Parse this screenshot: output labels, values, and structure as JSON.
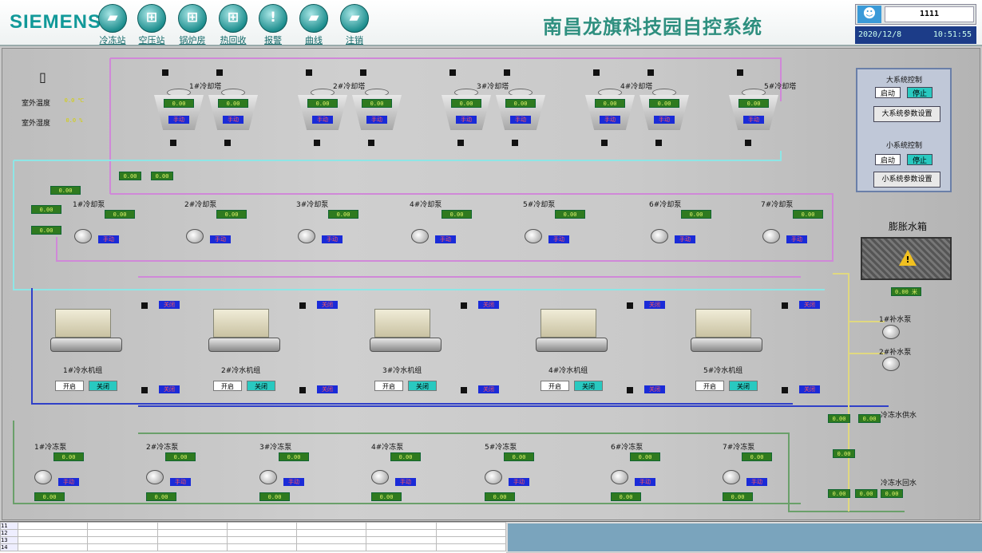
{
  "header": {
    "brand": "SIEMENS",
    "title": "南昌龙旗科技园自控系统",
    "nav": [
      {
        "label": "冷冻站",
        "icon": "folder-icon"
      },
      {
        "label": "空压站",
        "icon": "network-icon"
      },
      {
        "label": "锅炉房",
        "icon": "network-icon"
      },
      {
        "label": "热回收",
        "icon": "network-icon"
      },
      {
        "label": "报警",
        "icon": "warning-icon"
      },
      {
        "label": "曲线",
        "icon": "folder-icon"
      },
      {
        "label": "注销",
        "icon": "folder-icon"
      }
    ],
    "user": "1111",
    "date": "2020/12/8",
    "time": "10:51:55"
  },
  "outdoor": {
    "temp_label": "室外温度",
    "humid_label": "室外湿度",
    "temp_value": "0.0 ℃",
    "humid_value": "0.0 %"
  },
  "towers": [
    {
      "label": "1#冷却塔",
      "state": "手动"
    },
    {
      "label": "2#冷却塔",
      "state": "手动"
    },
    {
      "label": "3#冷却塔",
      "state": "手动"
    },
    {
      "label": "4#冷却塔",
      "state": "手动"
    },
    {
      "label": "5#冷却塔",
      "state": "手动"
    }
  ],
  "cooling_pumps": [
    "1#冷却泵",
    "2#冷却泵",
    "3#冷却泵",
    "4#冷却泵",
    "5#冷却泵",
    "6#冷却泵",
    "7#冷却泵"
  ],
  "chillers": [
    {
      "label": "1#冷水机组",
      "btn1": "开启",
      "btn2": "关闭"
    },
    {
      "label": "2#冷水机组",
      "btn1": "开启",
      "btn2": "关闭"
    },
    {
      "label": "3#冷水机组",
      "btn1": "开启",
      "btn2": "关闭"
    },
    {
      "label": "4#冷水机组",
      "btn1": "开启",
      "btn2": "关闭"
    },
    {
      "label": "5#冷水机组",
      "btn1": "开启",
      "btn2": "关闭"
    }
  ],
  "chilled_pumps": [
    "1#冷冻泵",
    "2#冷冻泵",
    "3#冷冻泵",
    "4#冷冻泵",
    "5#冷冻泵",
    "6#冷冻泵",
    "7#冷冻泵"
  ],
  "value_text": "0.00",
  "status_text": "手动",
  "valve_state": "关闭",
  "control": {
    "big_title": "大系统控制",
    "big_start": "启动",
    "big_stop": "停止",
    "big_param": "大系统参数设置",
    "small_title": "小系统控制",
    "small_start": "启动",
    "small_stop": "停止",
    "small_param": "小系统参数设置"
  },
  "tank": {
    "label": "膨胀水箱",
    "value": "0.00 米"
  },
  "makeup": {
    "pump1": "1#补水泵",
    "pump2": "2#补水泵"
  },
  "supply_label": "冷冻水供水",
  "return_label": "冷冻水回水",
  "rows": [
    "11",
    "12",
    "13",
    "14"
  ]
}
